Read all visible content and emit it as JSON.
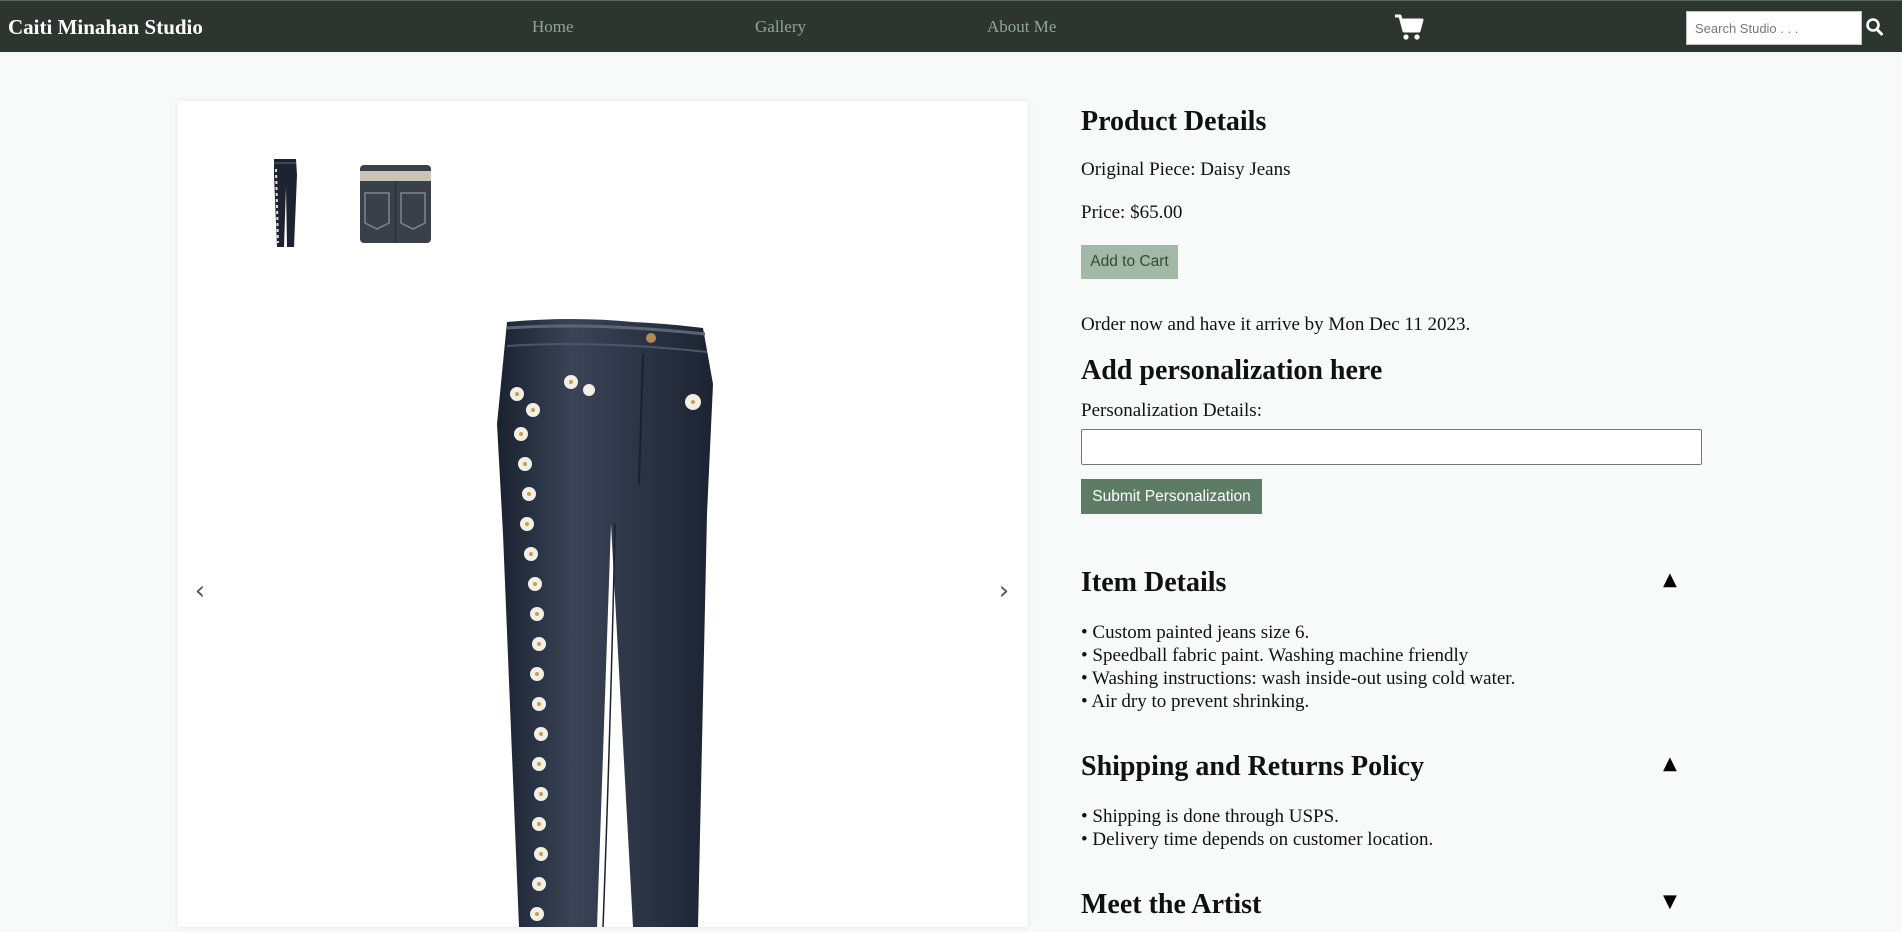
{
  "header": {
    "brand": "Caiti Minahan Studio",
    "nav": [
      "Home",
      "Gallery",
      "About Me"
    ],
    "cart_icon": "shopping-cart-icon",
    "search": {
      "placeholder": "Search Studio . . .",
      "value": ""
    },
    "search_icon": "magnifier-icon"
  },
  "gallery": {
    "prev_arrow": "‹",
    "next_arrow": "›",
    "thumbnails": [
      "jeans-front-thumbnail",
      "jeans-back-thumbnail"
    ],
    "main_image": "daisy-jeans-front"
  },
  "product": {
    "heading": "Product Details",
    "name_line": "Original Piece: Daisy Jeans",
    "price_line": "Price: $65.00",
    "add_to_cart": "Add to Cart",
    "delivery_line": "Order now and have it arrive by Mon Dec 11 2023."
  },
  "personalization": {
    "heading": "Add personalization here",
    "label": "Personalization Details:",
    "value": "",
    "submit": "Submit Personalization"
  },
  "sections": [
    {
      "title": "Item Details",
      "toggle": "▲",
      "items": [
        "• Custom painted jeans size 6.",
        "• Speedball fabric paint. Washing machine friendly",
        "• Washing instructions: wash inside-out using cold water.",
        "• Air dry to prevent shrinking."
      ]
    },
    {
      "title": "Shipping and Returns Policy",
      "toggle": "▲",
      "items": [
        "• Shipping is done through USPS.",
        "• Delivery time depends on customer location."
      ]
    },
    {
      "title": "Meet the Artist",
      "toggle": "▼",
      "items": []
    }
  ],
  "colors": {
    "header_bg": "#2d352f",
    "nav_link": "#8fa694",
    "add_to_cart_bg": "#a3b9a8",
    "submit_bg": "#5d7b65",
    "page_bg": "#f7faf8"
  }
}
